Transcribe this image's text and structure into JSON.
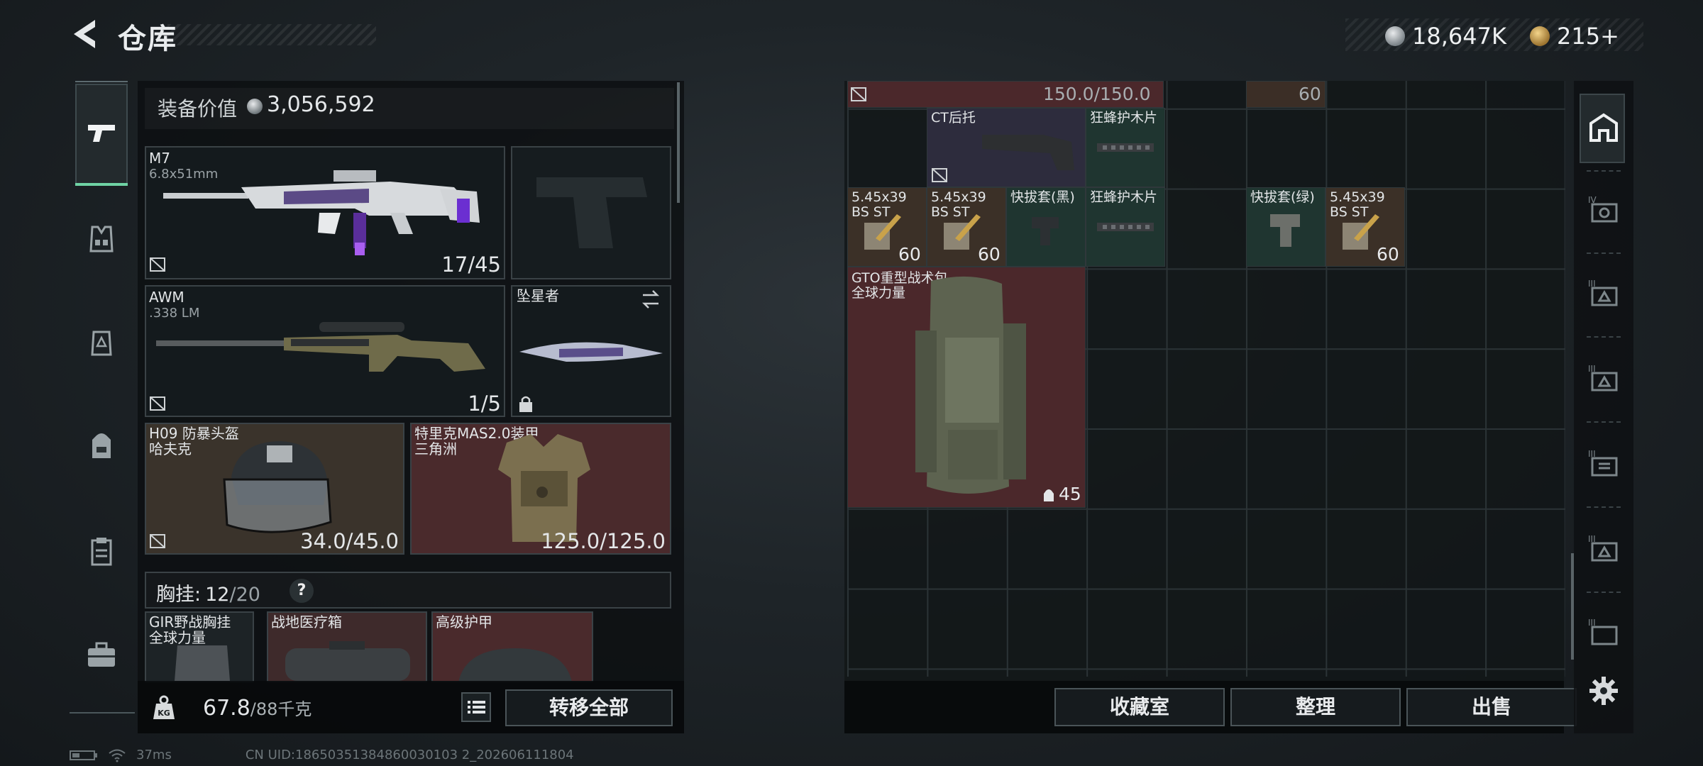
{
  "header": {
    "title": "仓库",
    "currency_silver": "18,647K",
    "currency_gold": "215+"
  },
  "sidebar": {
    "items": [
      {
        "name": "gun-icon",
        "selected": true
      },
      {
        "name": "vest-icon",
        "selected": false
      },
      {
        "name": "armor-icon",
        "selected": false
      },
      {
        "name": "backpack-icon",
        "selected": false
      },
      {
        "name": "clipboard-icon",
        "selected": false
      },
      {
        "name": "toolbox-icon",
        "selected": false
      }
    ]
  },
  "loadout": {
    "value_label": "装备价值",
    "value_number": "3,056,592",
    "primary": {
      "name": "M7",
      "caliber": "6.8x51mm",
      "ammo": "17/45"
    },
    "sniper": {
      "name": "AWM",
      "caliber": ".338 LM",
      "ammo": "1/5"
    },
    "melee": {
      "name": "坠星者"
    },
    "helmet": {
      "name": "H09 防暴头盔",
      "brand": "哈夫克",
      "durability": "34.0/45.0"
    },
    "armor": {
      "name": "特里克MAS2.0装甲",
      "brand": "三角洲",
      "durability": "125.0/125.0"
    },
    "chest": {
      "label": "胸挂:",
      "used": "12",
      "total": "/20",
      "help": "?"
    },
    "chest_items": [
      {
        "name": "GIR野战胸挂",
        "sub": "全球力量"
      },
      {
        "name": "战地医疗箱",
        "sub": ""
      },
      {
        "name": "高级护甲",
        "sub": ""
      }
    ]
  },
  "weight": {
    "value": "67.8",
    "max": "/88千克"
  },
  "buttons": {
    "transfer_all": "转移全部",
    "collection": "收藏室",
    "organize": "整理",
    "sell": "出售"
  },
  "stash": {
    "row0": {
      "durability": "150.0/150.0",
      "count": "60"
    },
    "items": [
      {
        "id": "ct-stock",
        "label": "CT后托",
        "count": ""
      },
      {
        "id": "frenzy-guard-1",
        "label": "狂蜂护木片",
        "count": ""
      },
      {
        "id": "ammo-1",
        "label": "5.45x39\nBS ST",
        "count": "60"
      },
      {
        "id": "ammo-2",
        "label": "5.45x39\nBS ST",
        "count": "60"
      },
      {
        "id": "holster-black",
        "label": "快拔套(黑)",
        "count": ""
      },
      {
        "id": "frenzy-guard-2",
        "label": "狂蜂护木片",
        "count": ""
      },
      {
        "id": "holster-green",
        "label": "快拔套(绿)",
        "count": ""
      },
      {
        "id": "ammo-3",
        "label": "5.45x39\nBS ST",
        "count": "60"
      },
      {
        "id": "gto-backpack",
        "label": "GTO重型战术包\n全球力量",
        "count": "45"
      }
    ]
  },
  "status": {
    "ping": "37ms",
    "uid": "CN UID:18650351384860030103 2_202606111804"
  },
  "colors": {
    "accent_green": "#6fd3a4",
    "rarity_red": "#5a2a2e",
    "rarity_gold": "#4a3b2b",
    "rarity_green": "#1f3530",
    "rarity_purple": "#34304a"
  }
}
